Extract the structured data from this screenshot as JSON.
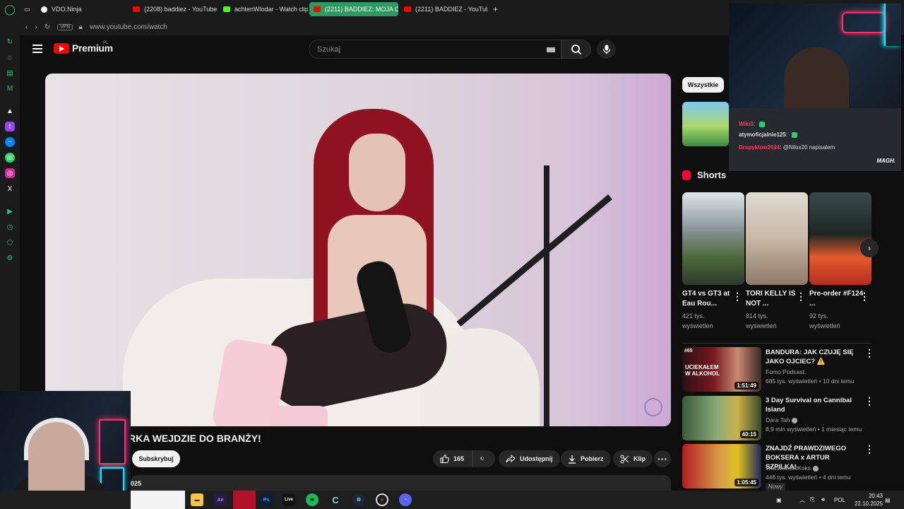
{
  "browser": {
    "tabs": [
      {
        "title": "VDO.Ninja",
        "color": "#ffffff"
      },
      {
        "title": "(2208) baddiez - YouTube",
        "color": "#ff0000"
      },
      {
        "title": "achtenWlodar - Watch clip",
        "color": "#53fc18"
      },
      {
        "title": "(2211) BADDIEZ: MOJA C",
        "color": "#ff0000",
        "active": true
      },
      {
        "title": "(2211) BADDIEZ - YouTube",
        "color": "#ff0000"
      }
    ],
    "new_tab": "+",
    "vpn": "VPN",
    "url": "www.youtube.com/watch",
    "accent": "#2d9a61"
  },
  "youtube": {
    "brand": "Premium",
    "region": "PL",
    "search_placeholder": "Szukaj",
    "brand_color": "#ff0000"
  },
  "video": {
    "title": "RKA WEJDZIE DO BRANŻY!",
    "subscribe": "Subskrybuj",
    "likes": "165",
    "share": "Udostępnij",
    "download": "Pobierz",
    "clip": "Klip",
    "desc_text": "025"
  },
  "stream_chat": [
    {
      "user": "Wiki0",
      "text": ":"
    },
    {
      "user": "atymoficjalnie125",
      "text": ":"
    },
    {
      "user": "Drapyklow2024",
      "text": ": @Nilox20 napisalem"
    }
  ],
  "stream_logo": "MAGH.",
  "sidebar_right": {
    "chip": "Wszystkie",
    "shorts_heading": "Shorts",
    "shorts": [
      {
        "title": "GT4 vs GT3 at Eau Rou...",
        "views": "421 tys. wyświetleń"
      },
      {
        "title": "TORI KELLY IS NOT ...",
        "views": "814 tys. wyświetleń"
      },
      {
        "title": "Pre-order #F124 ...",
        "views": "92 tys. wyświetleń"
      }
    ],
    "recommended": [
      {
        "title": "BANDURA: JAK CZUJĘ SIĘ JAKO OJCIEC? ⚠️",
        "channel": "Fomo Podcast.",
        "meta": "685 tys. wyświetleń • 10 dni temu",
        "duration": "1:51:49",
        "thumb_text": "UCIEKAŁEM W ALKOHOL",
        "thumb_num": "#65"
      },
      {
        "title": "3 Day Survival on Cannibal Island",
        "channel": "Dara Tah",
        "meta": "8,9 mln wyświetleń • 1 miesiąc temu",
        "duration": "40:15"
      },
      {
        "title": "ZNAJDŹ PRAWDZIWEGO BOKSERA x ARTUR SZPILKA!",
        "channel": "WarszawskiKoks",
        "meta": "446 tys. wyświetleń • 4 dni temu",
        "duration": "1:05:45",
        "badge": "Nowy"
      }
    ]
  },
  "taskbar": {
    "apps": [
      "Ae",
      "Ps",
      "Live"
    ],
    "lang": "POL",
    "time": "20:43",
    "date": "22.10.2025"
  }
}
